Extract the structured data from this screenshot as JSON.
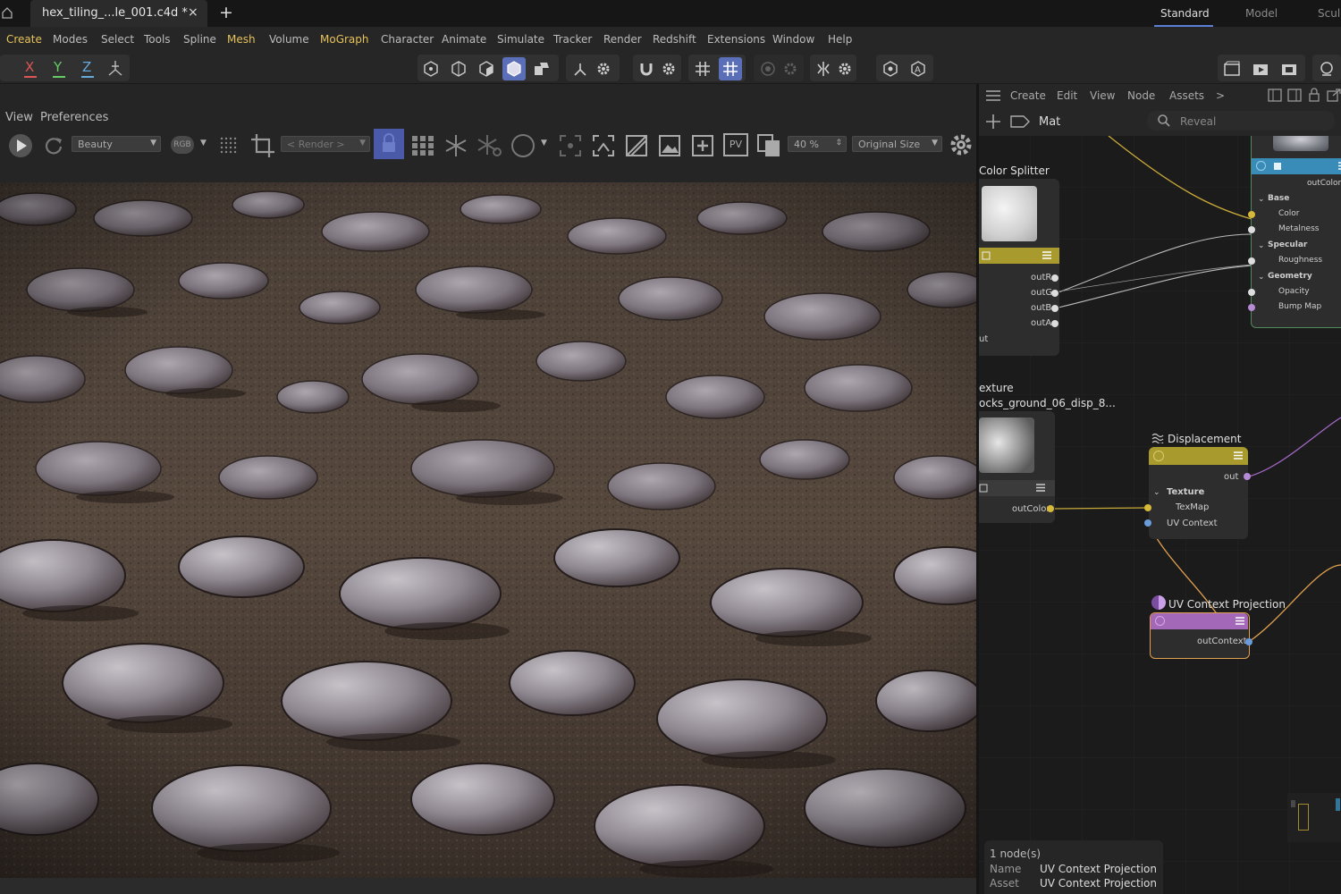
{
  "tabs": {
    "document": "hex_tiling_...le_001.c4d *",
    "close": "×",
    "add": "+",
    "layouts": [
      "Standard",
      "Model",
      "Scul"
    ]
  },
  "menu": [
    "Create",
    "Modes",
    "Select",
    "Tools",
    "Spline",
    "Mesh",
    "Volume",
    "MoGraph",
    "Character",
    "Animate",
    "Simulate",
    "Tracker",
    "Render",
    "Redshift",
    "Extensions",
    "Window",
    "Help"
  ],
  "axes": {
    "x": "X",
    "y": "Y",
    "z": "Z"
  },
  "viewer": {
    "menu": [
      "View",
      "Preferences"
    ],
    "aov": "Beauty",
    "rgb": "RGB",
    "render_region": "< Render >",
    "pv": "PV",
    "zoom": "40 %",
    "size": "Original Size"
  },
  "node_editor": {
    "menu": [
      "Create",
      "Edit",
      "View",
      "Node",
      "Assets"
    ],
    "more": ">",
    "material": "Mat",
    "search_placeholder": "Reveal",
    "color_splitter": {
      "title": "Color Splitter",
      "ports": [
        "outR",
        "outG",
        "outB",
        "outA"
      ],
      "partial": "ut"
    },
    "texture": {
      "title": "exture",
      "file": "ocks_ground_06_disp_8...",
      "port": "outColor"
    },
    "displacement": {
      "title": "Displacement",
      "out": "out",
      "group": "Texture",
      "inputs": [
        "TexMap",
        "UV Context"
      ]
    },
    "uv_projection": {
      "title": "UV Context Projection",
      "port": "outContext"
    },
    "material_node": {
      "out": "outColor",
      "sections": [
        {
          "name": "Base",
          "items": [
            "Color",
            "Metalness"
          ]
        },
        {
          "name": "Specular",
          "items": [
            "Roughness"
          ]
        },
        {
          "name": "Geometry",
          "items": [
            "Opacity",
            "Bump Map"
          ]
        }
      ]
    }
  },
  "info": {
    "count": "1 node(s)",
    "name_label": "Name",
    "name_value": "UV Context Projection",
    "asset_label": "Asset",
    "asset_value": "UV Context Projection"
  },
  "colors": {
    "accent_yellow": "#e7c25a",
    "active_blue": "#5a6fb8",
    "node_header_yellow": "#a89a2c",
    "node_header_purple": "#a468b8",
    "material_green": "#4f8a5c",
    "selection_orange": "#e0a050"
  },
  "icons": [
    "home-icon",
    "play-icon",
    "refresh-icon",
    "gear-icon",
    "lock-icon",
    "search-icon",
    "hamburger-icon"
  ]
}
